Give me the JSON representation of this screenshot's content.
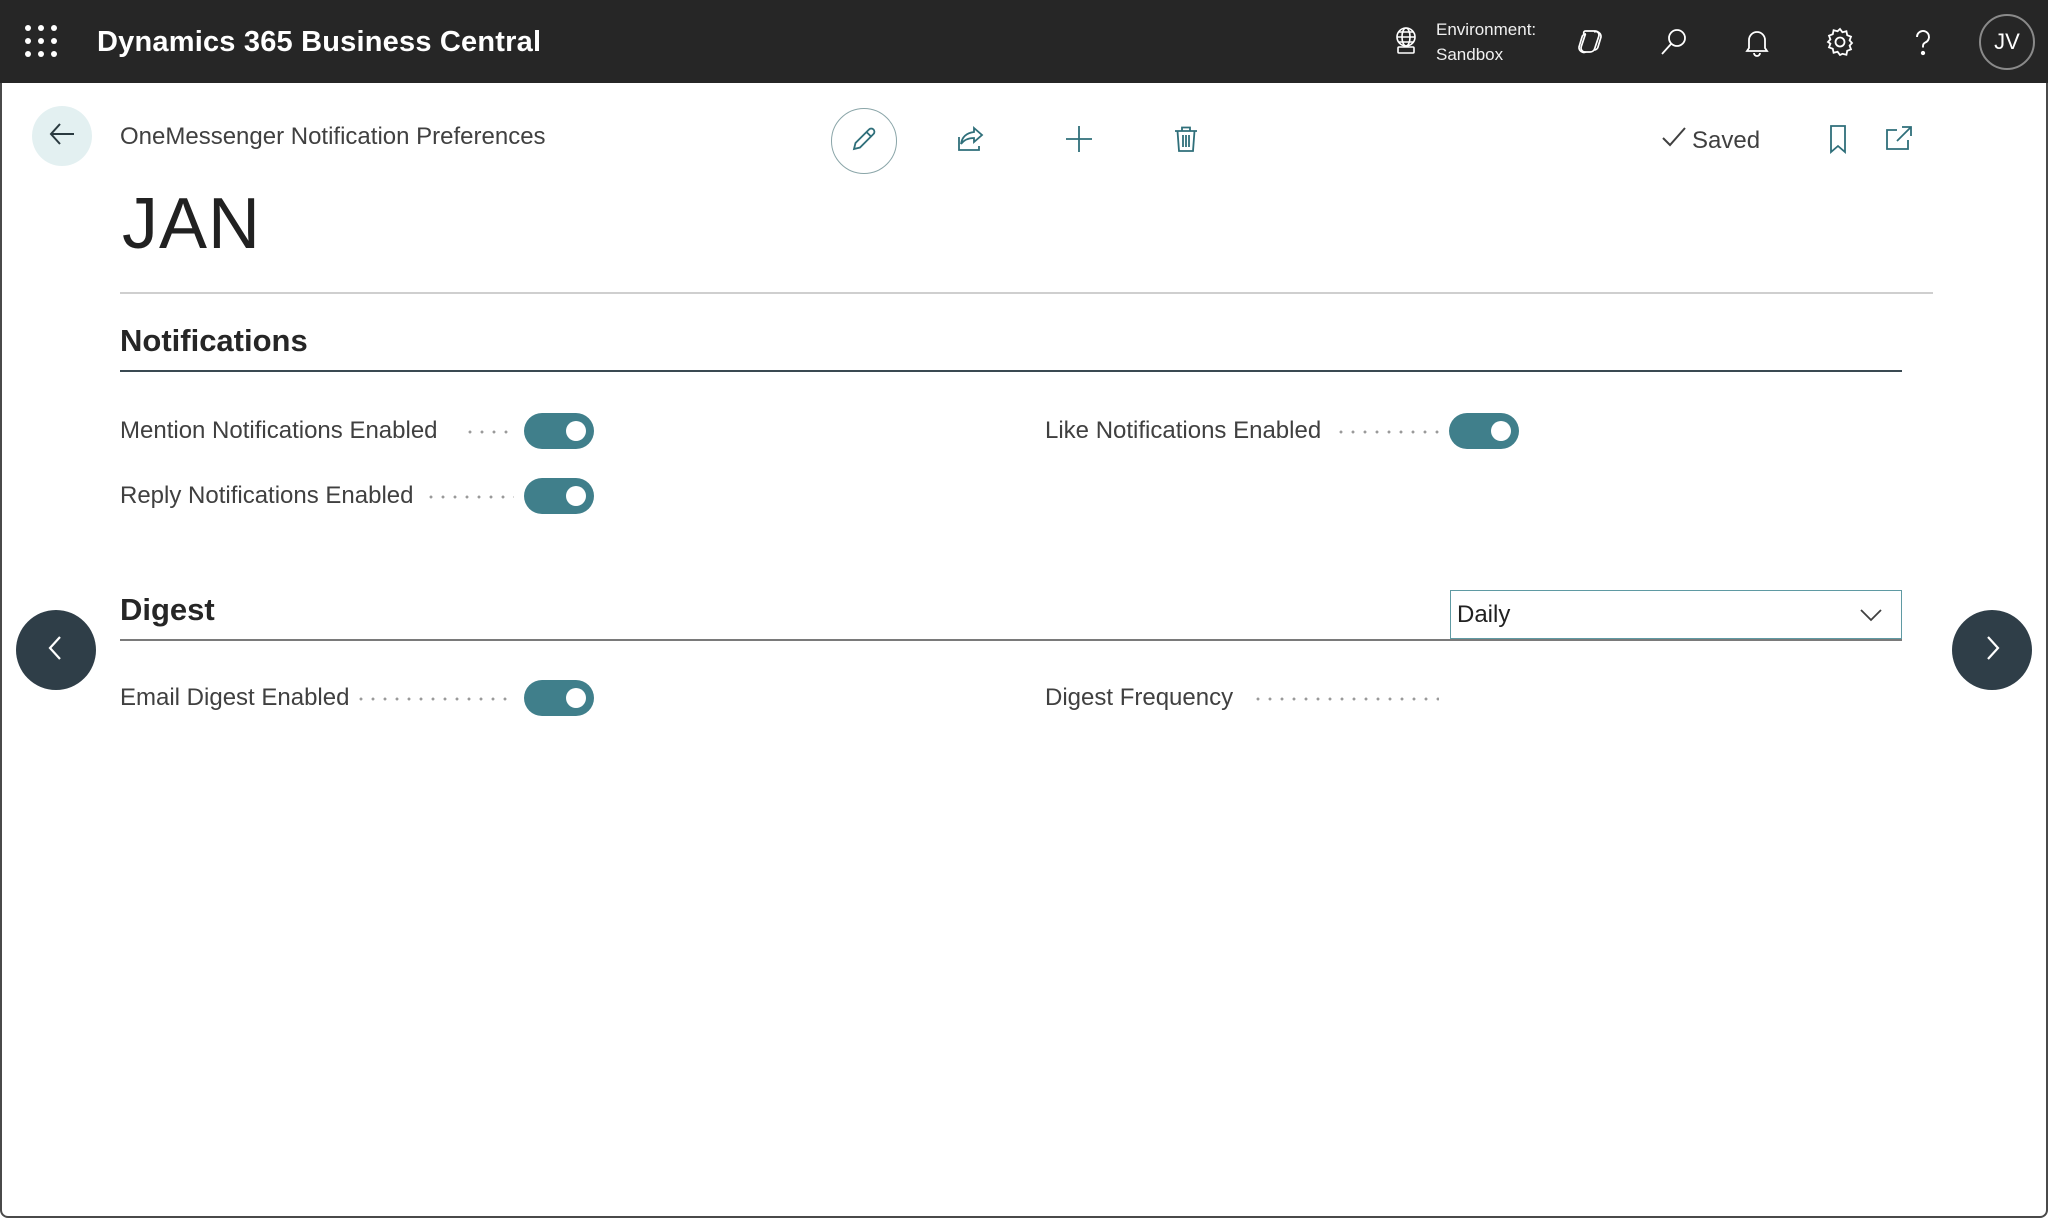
{
  "topbar": {
    "app_title": "Dynamics 365 Business Central",
    "environment_label": "Environment:",
    "environment_value": "Sandbox",
    "avatar_initials": "JV"
  },
  "header": {
    "breadcrumb": "OneMessenger Notification Preferences",
    "saved_label": "Saved",
    "record_title": "JAN"
  },
  "sections": {
    "notifications": {
      "title": "Notifications",
      "mention_label": "Mention Notifications Enabled",
      "mention_value": true,
      "reply_label": "Reply Notifications Enabled",
      "reply_value": true,
      "like_label": "Like Notifications Enabled",
      "like_value": true
    },
    "digest": {
      "title": "Digest",
      "email_label": "Email Digest Enabled",
      "email_value": true,
      "frequency_label": "Digest Frequency",
      "frequency_value": "Daily"
    }
  },
  "colors": {
    "topbar": "#262626",
    "toggle_on": "#407f8b",
    "nav_circle": "#2f3e48",
    "accent_border": "#5f9aa3"
  },
  "icons": [
    "waffle-icon",
    "globe-icon",
    "copilot-icon",
    "search-icon",
    "bell-icon",
    "gear-icon",
    "help-icon",
    "back-arrow-icon",
    "pencil-icon",
    "share-icon",
    "plus-icon",
    "trash-icon",
    "checkmark-icon",
    "bookmark-icon",
    "popout-icon",
    "chevron-down-icon",
    "chevron-left-icon",
    "chevron-right-icon"
  ]
}
